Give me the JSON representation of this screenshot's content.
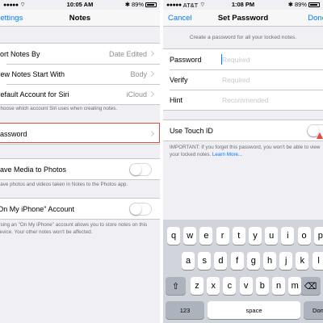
{
  "left": {
    "status": {
      "time": "10:05 AM",
      "carrier": "",
      "battery": "89%"
    },
    "nav": {
      "back": "Settings",
      "title": "Notes"
    },
    "group1": [
      {
        "label": "Sort Notes By",
        "value": "Date Edited"
      },
      {
        "label": "New Notes Start With",
        "value": "Body"
      },
      {
        "label": "Default Account for Siri",
        "value": "iCloud"
      }
    ],
    "group1_note": "Choose which account Siri uses when creating notes.",
    "password_label": "Password",
    "save_media_label": "Save Media to Photos",
    "save_media_note": "Save photos and videos taken in Notes to the Photos app.",
    "on_my_iphone_label": "\"On My iPhone\" Account",
    "on_my_iphone_note": "Using an \"On My iPhone\" account allows you to store notes on this device. Your other notes won't be affected."
  },
  "right": {
    "status": {
      "carrier": "AT&T",
      "time": "1:08 PM",
      "battery": "89%"
    },
    "nav": {
      "cancel": "Cancel",
      "title": "Set Password",
      "done": "Done"
    },
    "intro": "Create a password for all your locked notes.",
    "fields": [
      {
        "label": "Password",
        "placeholder": "Required"
      },
      {
        "label": "Verify",
        "placeholder": "Required"
      },
      {
        "label": "Hint",
        "placeholder": "Recommended"
      }
    ],
    "touch_id_label": "Use Touch ID",
    "important_note": "IMPORTANT: If you forget this password, you won't be able to view your locked notes.",
    "learn_more": "Learn More...",
    "keyboard": {
      "row1": [
        "q",
        "w",
        "e",
        "r",
        "t",
        "y",
        "u",
        "i",
        "o",
        "p"
      ],
      "row2": [
        "a",
        "s",
        "d",
        "f",
        "g",
        "h",
        "j",
        "k",
        "l"
      ],
      "row3": [
        "z",
        "x",
        "c",
        "v",
        "b",
        "n",
        "m"
      ],
      "numbers_key": "123",
      "space_key": "space",
      "return_key": "Done"
    }
  },
  "colors": {
    "accent": "#007aff",
    "highlight": "#e44b3c",
    "keyboard_bg": "#d1d4da"
  }
}
